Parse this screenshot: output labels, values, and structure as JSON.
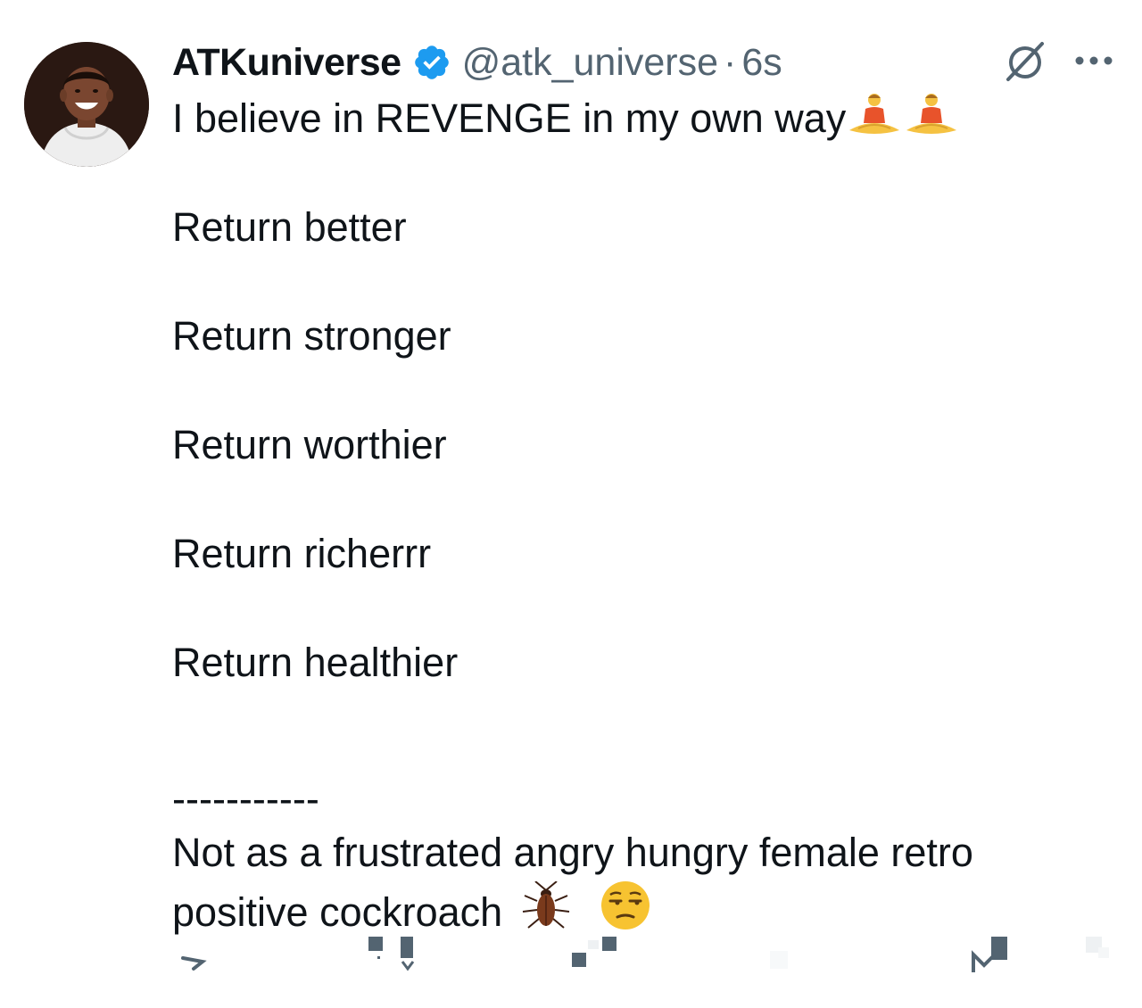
{
  "author": {
    "display_name": "ATKuniverse",
    "handle": "@atk_universe",
    "separator": "·",
    "time": "6s",
    "avatar_icon": "profile-photo",
    "verified_color": "#1d9bf0"
  },
  "tweet": {
    "line_1": "I believe in REVENGE in my own way",
    "line_2": "Return better",
    "line_3": "Return stronger",
    "line_4": "Return worthier",
    "line_5": "Return richerrr",
    "line_6": "Return healthier",
    "divider": "-----------",
    "line_7": "Not as a frustrated angry hungry female retro",
    "line_8": "positive cockroach"
  },
  "icons": {
    "grok": "grok-icon",
    "more": "more-icon",
    "reply": "reply-icon",
    "retweet": "retweet-icon",
    "like": "like-icon",
    "views": "views-icon",
    "bookmark": "bookmark-icon",
    "share": "share-icon",
    "meditation": "person-in-lotus-position-emoji",
    "cockroach": "cockroach-emoji",
    "unamused": "unamused-face-emoji"
  },
  "colors": {
    "text": "#0f1419",
    "secondary": "#536471",
    "accent": "#1d9bf0"
  }
}
